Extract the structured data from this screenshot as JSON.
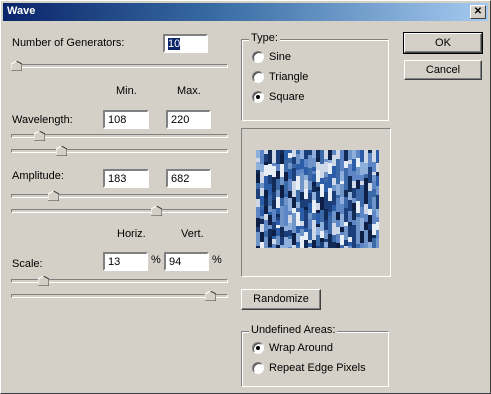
{
  "window": {
    "title": "Wave",
    "close_glyph": "✕"
  },
  "generators": {
    "label": "Number of Generators:",
    "value": "10",
    "slider_fraction": 0.0
  },
  "columns": {
    "min": "Min.",
    "max": "Max.",
    "horiz": "Horiz.",
    "vert": "Vert."
  },
  "wavelength": {
    "label": "Wavelength:",
    "min": "108",
    "max": "220",
    "min_slider": 0.11,
    "max_slider": 0.22
  },
  "amplitude": {
    "label": "Amplitude:",
    "min": "183",
    "max": "682",
    "min_slider": 0.18,
    "max_slider": 0.68
  },
  "scale": {
    "label": "Scale:",
    "horiz": "13",
    "vert": "94",
    "unit": "%",
    "horiz_slider": 0.13,
    "vert_slider": 0.94
  },
  "type_group": {
    "title": "Type:",
    "options": [
      {
        "label": "Sine",
        "selected": false
      },
      {
        "label": "Triangle",
        "selected": false
      },
      {
        "label": "Square",
        "selected": true
      }
    ]
  },
  "buttons": {
    "ok": "OK",
    "cancel": "Cancel",
    "randomize": "Randomize"
  },
  "undefined_areas": {
    "title": "Undefined Areas:",
    "options": [
      {
        "label": "Wrap Around",
        "selected": true
      },
      {
        "label": "Repeat Edge Pixels",
        "selected": false
      }
    ]
  },
  "colors": {
    "title_start": "#0a246a",
    "title_end": "#a6caf0",
    "face": "#d4d0c8",
    "selection": "#0a246a"
  }
}
